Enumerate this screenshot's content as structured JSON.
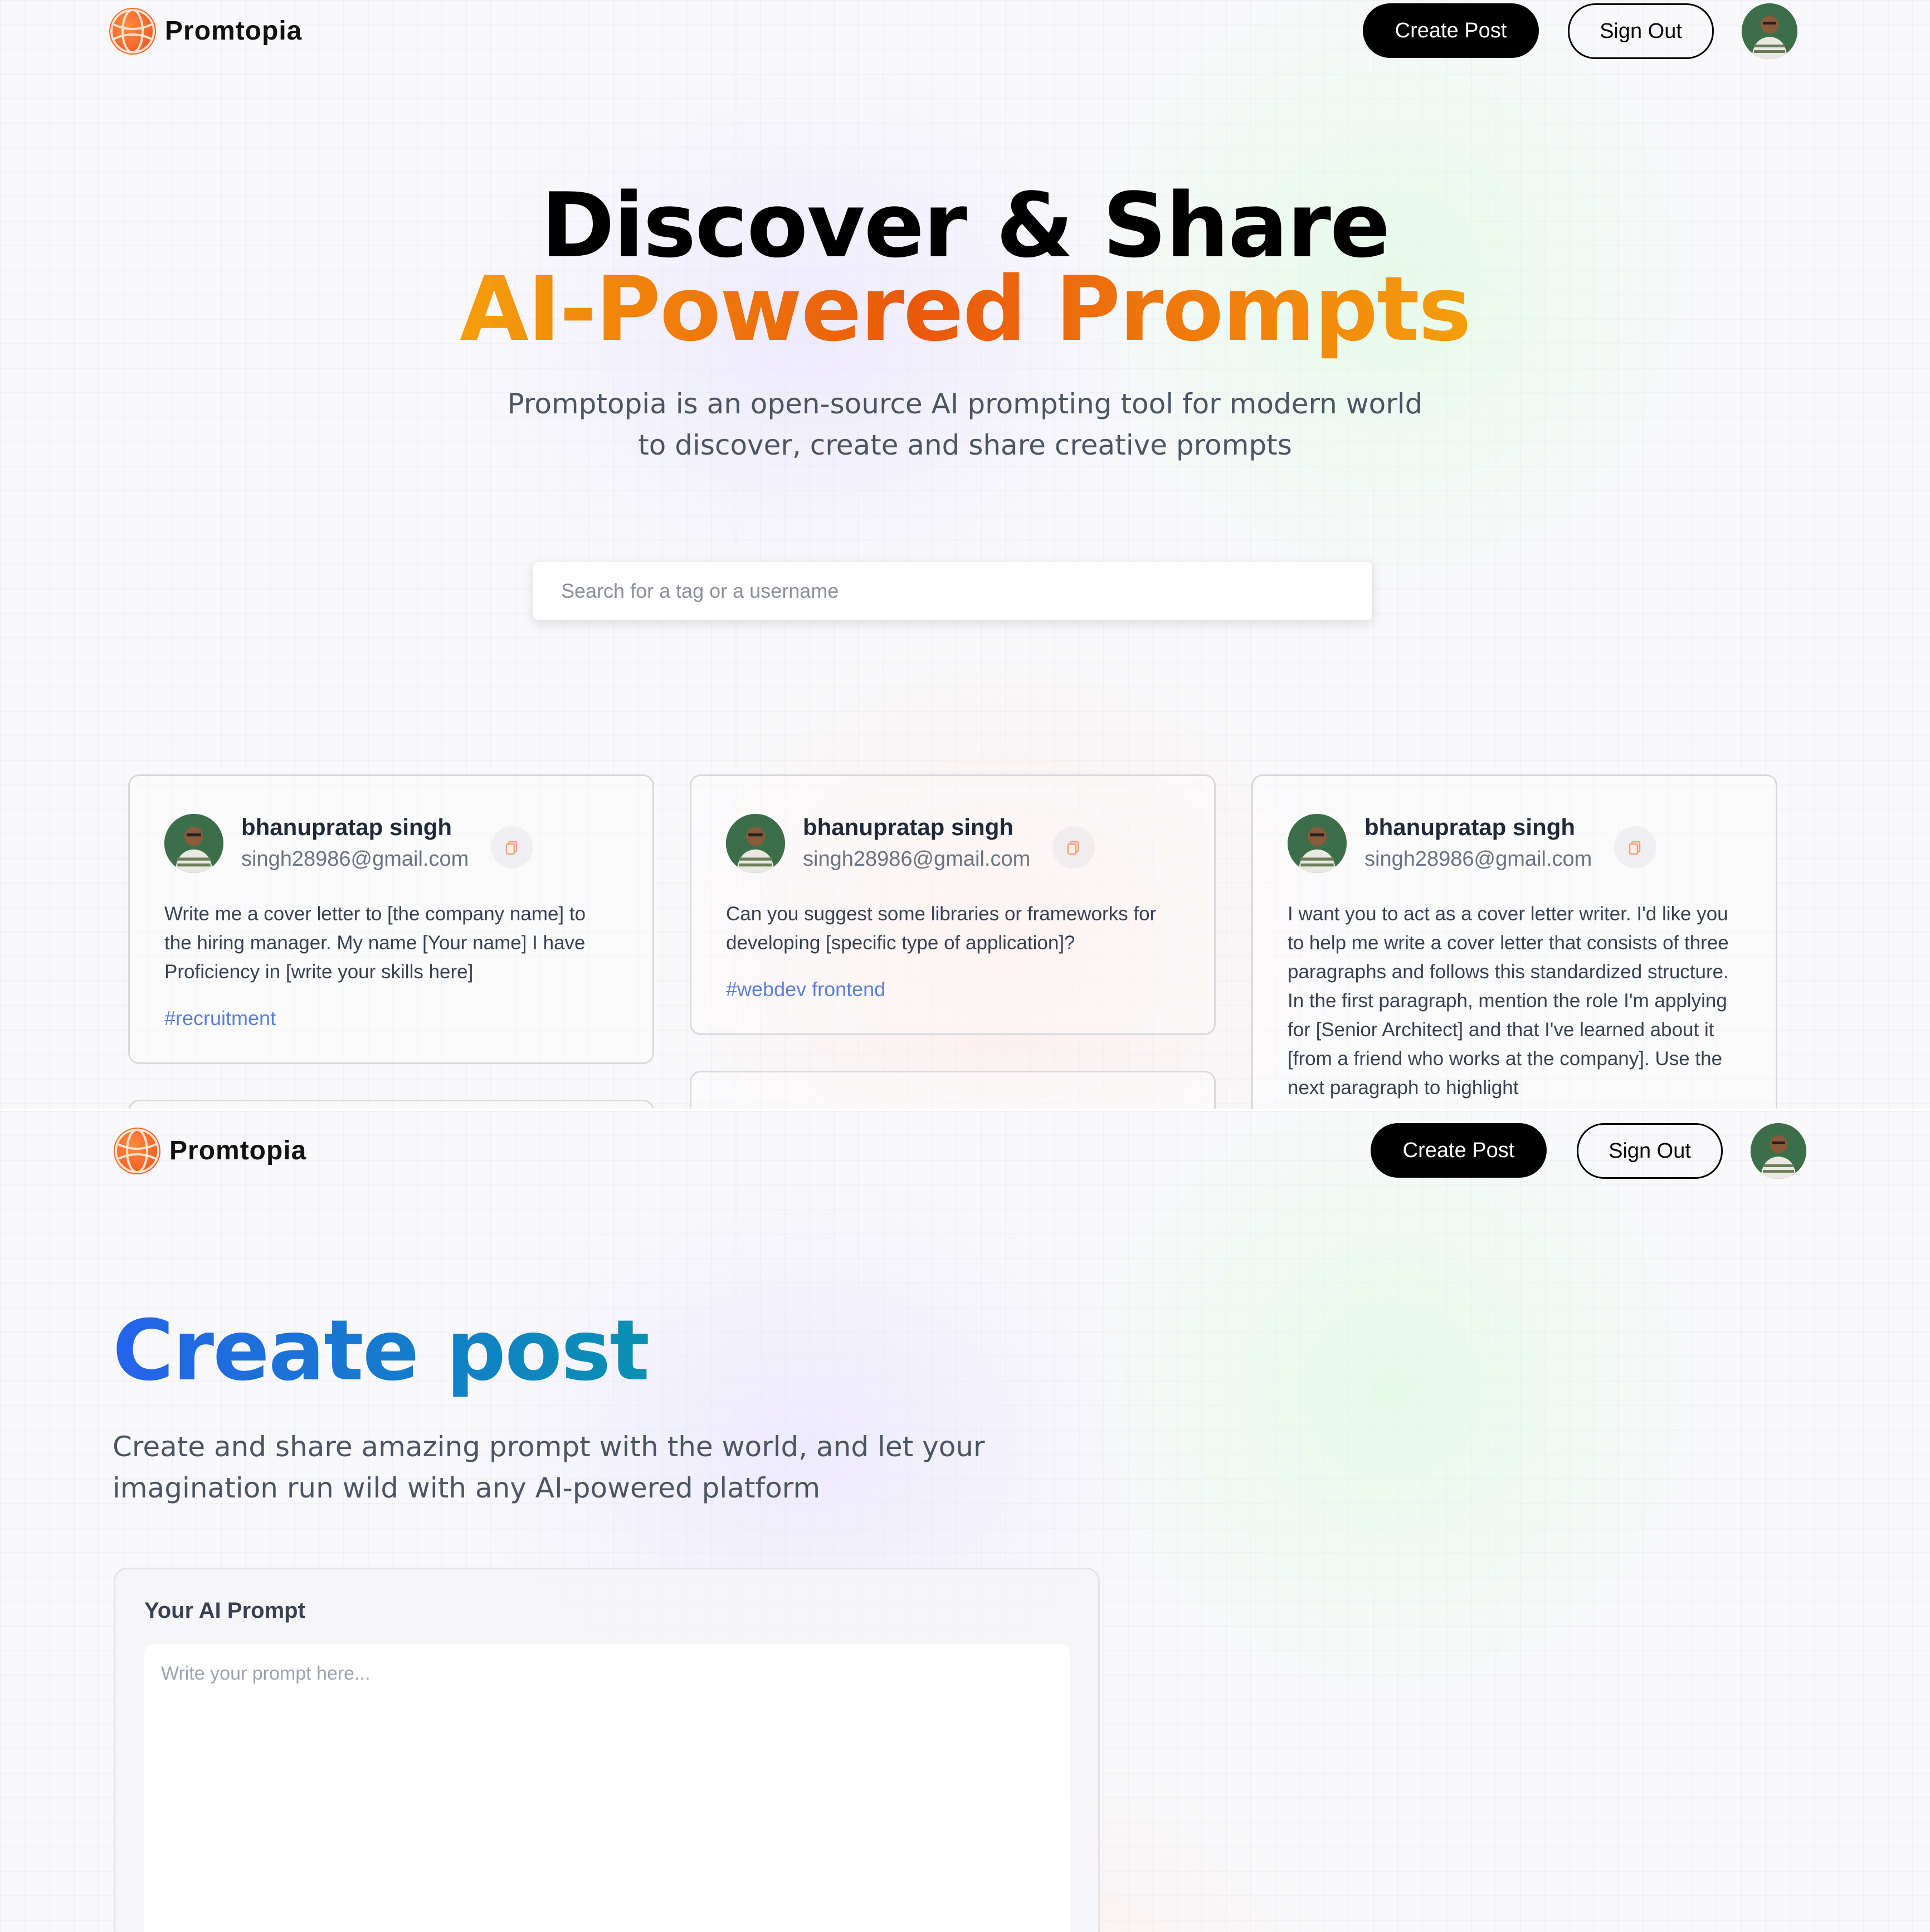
{
  "nav": {
    "brand": "Promtopia",
    "create_post_label": "Create Post",
    "sign_out_label": "Sign Out"
  },
  "hero": {
    "title_line1": "Discover & Share",
    "title_line2": "AI-Powered Prompts",
    "description": "Promptopia is an open-source AI prompting tool for modern world to discover, create and share creative prompts"
  },
  "search": {
    "placeholder": "Search for a tag or a username"
  },
  "feed": {
    "cards": [
      {
        "username": "bhanupratap singh",
        "email": "singh28986@gmail.com",
        "prompt": "Write me a cover letter to [the company name] to the hiring manager. My name [Your name] I have Proficiency in [write your skills here]",
        "tag": "#recruitment"
      },
      {
        "username": "bhanupratap singh",
        "email": "singh28986@gmail.com",
        "prompt": "Can you suggest some libraries or frameworks for developing [specific type of application]?",
        "tag": "#webdev frontend"
      },
      {
        "username": "bhanupratap singh",
        "email": "singh28986@gmail.com",
        "prompt": "I want you to act as a cover letter writer. I'd like you to help me write a cover letter that consists of three paragraphs and follows this standardized structure. In the first paragraph, mention the role I'm applying for [Senior Architect] and that I've learned about it [from a friend who works at the company]. Use the next paragraph to highlight",
        "tag": ""
      }
    ]
  },
  "create": {
    "title": "Create post",
    "description": "Create and share amazing prompt with the world, and let your imagination run wild with any AI-powered platform",
    "prompt_label": "Your AI Prompt",
    "prompt_placeholder": "Write your prompt here...",
    "prompt_value": ""
  },
  "colors": {
    "accent_orange": "#ea580c",
    "accent_blue": "#2563eb",
    "tag_blue": "#5b7fd6"
  },
  "icons": {
    "logo": "globe-logo-icon",
    "copy": "copy-icon",
    "avatar": "user-avatar"
  }
}
